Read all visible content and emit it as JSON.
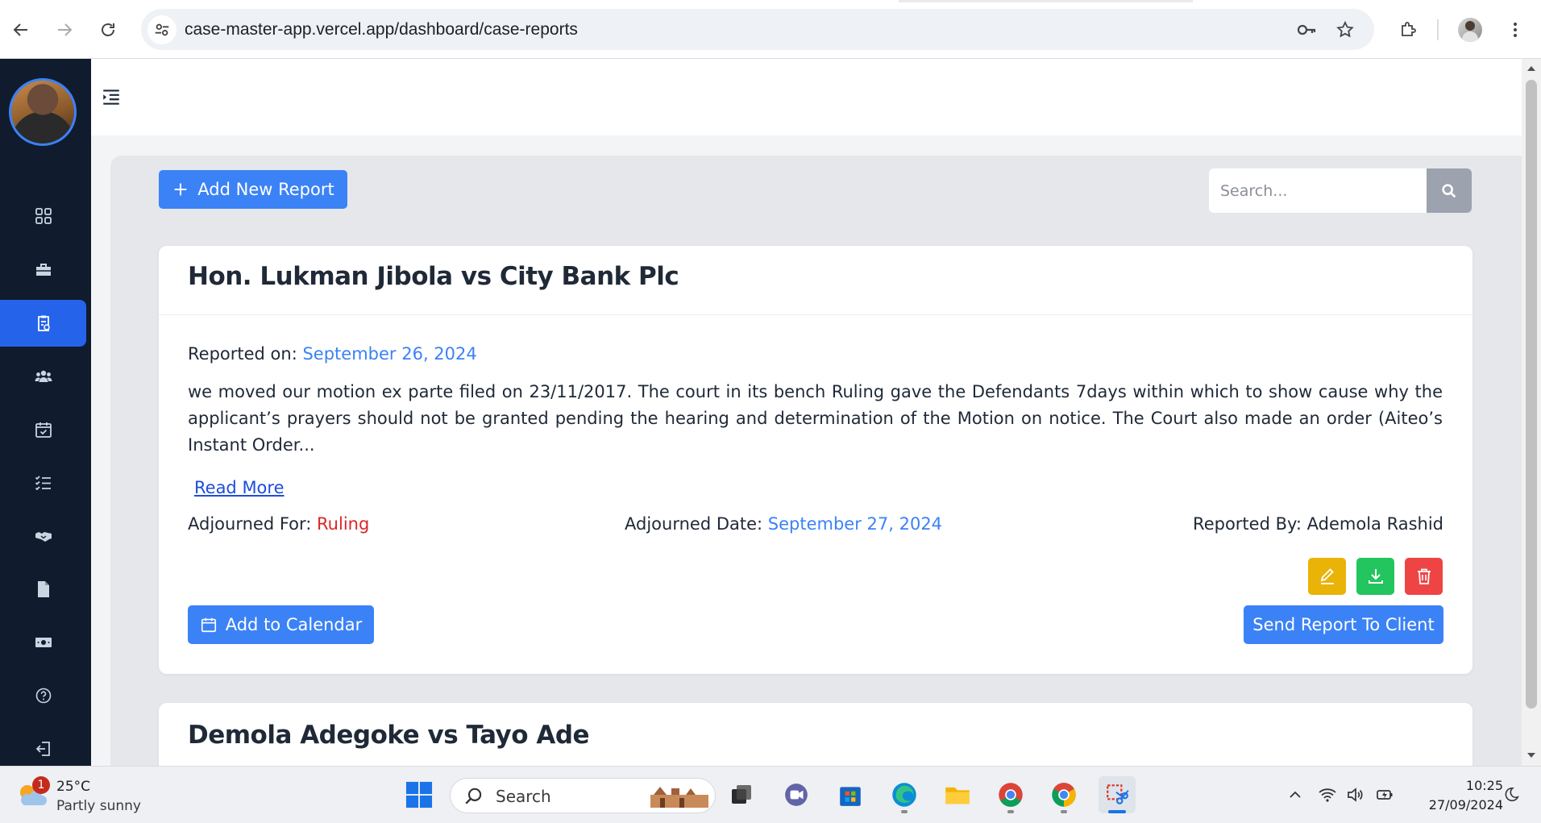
{
  "browser": {
    "url": "case-master-app.vercel.app/dashboard/case-reports"
  },
  "toolbar": {
    "add_report_label": "Add New Report",
    "search_placeholder": "Search..."
  },
  "reports": [
    {
      "title": "Hon. Lukman Jibola vs City Bank Plc",
      "reported_on_label": "Reported on:",
      "reported_on": "September 26, 2024",
      "summary": "we moved our motion ex parte filed on 23/11/2017. The court in its bench Ruling gave the Defendants 7days within which to show cause why the applicant’s prayers should not be granted pending the hearing and determination of the Motion on notice. The Court also made an order (Aiteo’s Instant Order...",
      "read_more_label": "Read More",
      "adjourned_for_label": "Adjourned For:",
      "adjourned_for": "Ruling",
      "adjourned_date_label": "Adjourned Date:",
      "adjourned_date": "September 27, 2024",
      "reported_by_label": "Reported By:",
      "reported_by": "Ademola Rashid",
      "add_calendar_label": "Add to Calendar",
      "send_report_label": "Send Report To Client"
    },
    {
      "title": "Demola Adegoke vs Tayo Ade"
    }
  ],
  "colors": {
    "primary": "#3b82f6",
    "sidebar_bg": "#101b2e",
    "edit": "#eab308",
    "download": "#22c55e",
    "delete": "#ef4444",
    "adjourned_for": "#dc2626"
  },
  "taskbar": {
    "weather_badge": "1",
    "temperature": "25°C",
    "weather_desc": "Partly sunny",
    "search_label": "Search",
    "time": "10:25",
    "date": "27/09/2024"
  }
}
